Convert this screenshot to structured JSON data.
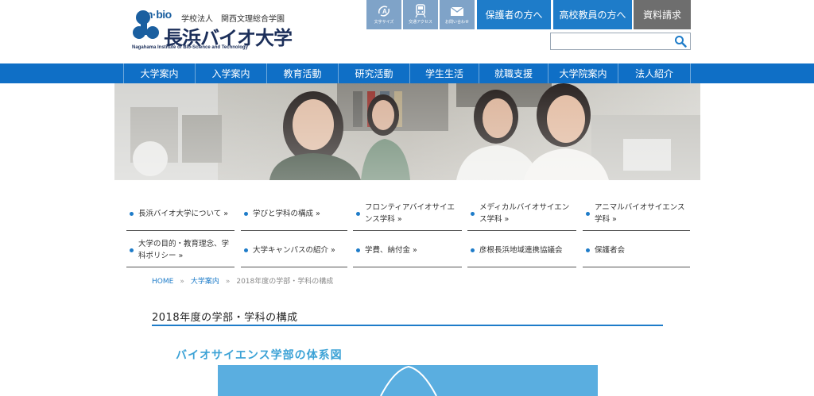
{
  "header": {
    "logo": {
      "mark": "n·bio",
      "corp": "学校法人　関西文理総合学園",
      "name": "長浜バイオ大学",
      "english": "Nagahama Institute of Bio-Science and Technology"
    },
    "utility": [
      {
        "label": "文字サイズ",
        "icon": "font-size-icon"
      },
      {
        "label": "交通アクセス",
        "icon": "train-icon"
      },
      {
        "label": "お問い合わせ",
        "icon": "mail-icon"
      }
    ],
    "buttons": {
      "parents": "保護者の方へ",
      "teachers": "高校教員の方へ",
      "request": "資料請求"
    },
    "search": {
      "placeholder": "",
      "value": ""
    }
  },
  "nav": [
    "大学案内",
    "入学案内",
    "教育活動",
    "研究活動",
    "学生生活",
    "就職支援",
    "大学院案内",
    "法人紹介"
  ],
  "subnav": [
    [
      "長浜バイオ大学について »",
      "学びと学科の構成 »",
      "フロンティアバイオサイエンス学科 »",
      "メディカルバイオサイエンス学科 »",
      "アニマルバイオサイエンス学科 »"
    ],
    [
      "大学の目的・教育理念、学科ポリシー »",
      "大学キャンパスの紹介 »",
      "学費、納付金 »",
      "彦根長浜地域連携協議会",
      "保護者会"
    ]
  ],
  "breadcrumb": {
    "home": "HOME",
    "section": "大学案内",
    "current": "2018年度の学部・学科の構成",
    "sep": "»"
  },
  "page_title": "2018年度の学部・学科の構成",
  "section_title": "バイオサイエンス学部の体系図",
  "colors": {
    "primary": "#0f6fc6",
    "accent": "#3ba2d6",
    "utility": "#7fa3c8",
    "gray_button": "#6e6e6e"
  }
}
